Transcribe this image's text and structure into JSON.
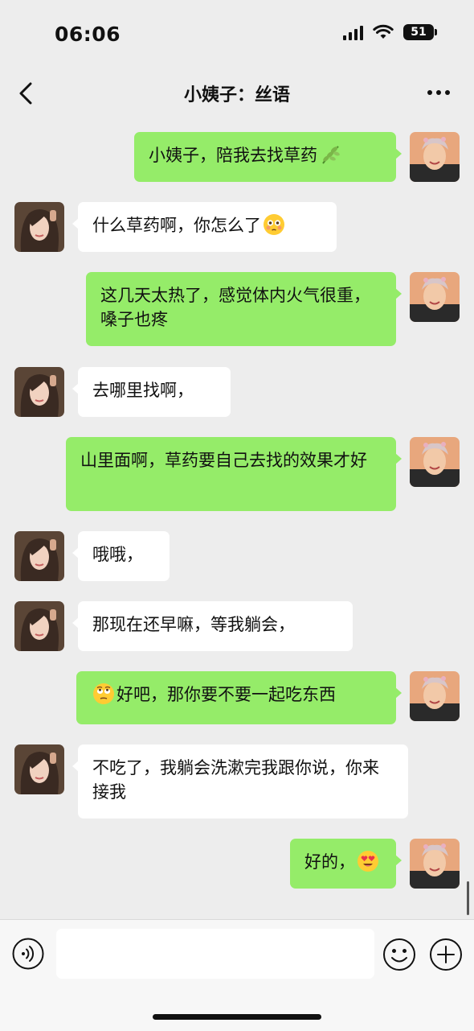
{
  "status_bar": {
    "time": "06:06",
    "battery_level": "51"
  },
  "header": {
    "title": "小姨子：丝语"
  },
  "messages": [
    {
      "side": "right",
      "text": "小姨子，陪我去找草药",
      "emoji_after": "herb-icon"
    },
    {
      "side": "left",
      "text": "什么草药啊，你怎么了",
      "emoji_after": "flushed-face-icon"
    },
    {
      "side": "right",
      "text": "这几天太热了，感觉体内火气很重，嗓子也疼"
    },
    {
      "side": "left",
      "text": "去哪里找啊，"
    },
    {
      "side": "right",
      "text": "山里面啊，草药要自己去找的效果才好"
    },
    {
      "side": "left",
      "text": "哦哦，"
    },
    {
      "side": "left",
      "text": "那现在还早嘛，等我躺会，"
    },
    {
      "side": "right",
      "text": "好吧，那你要不要一起吃东西",
      "emoji_before": "face-with-rolling-eyes-icon"
    },
    {
      "side": "left",
      "text": "不吃了，我躺会洗漱完我跟你说，你来接我"
    },
    {
      "side": "right",
      "text": "好的，",
      "emoji_after": "heart-eyes-face-icon"
    }
  ],
  "input_bar": {
    "placeholder": ""
  },
  "colors": {
    "background": "#ededed",
    "sent_bubble": "#95ec69",
    "received_bubble": "#ffffff"
  }
}
